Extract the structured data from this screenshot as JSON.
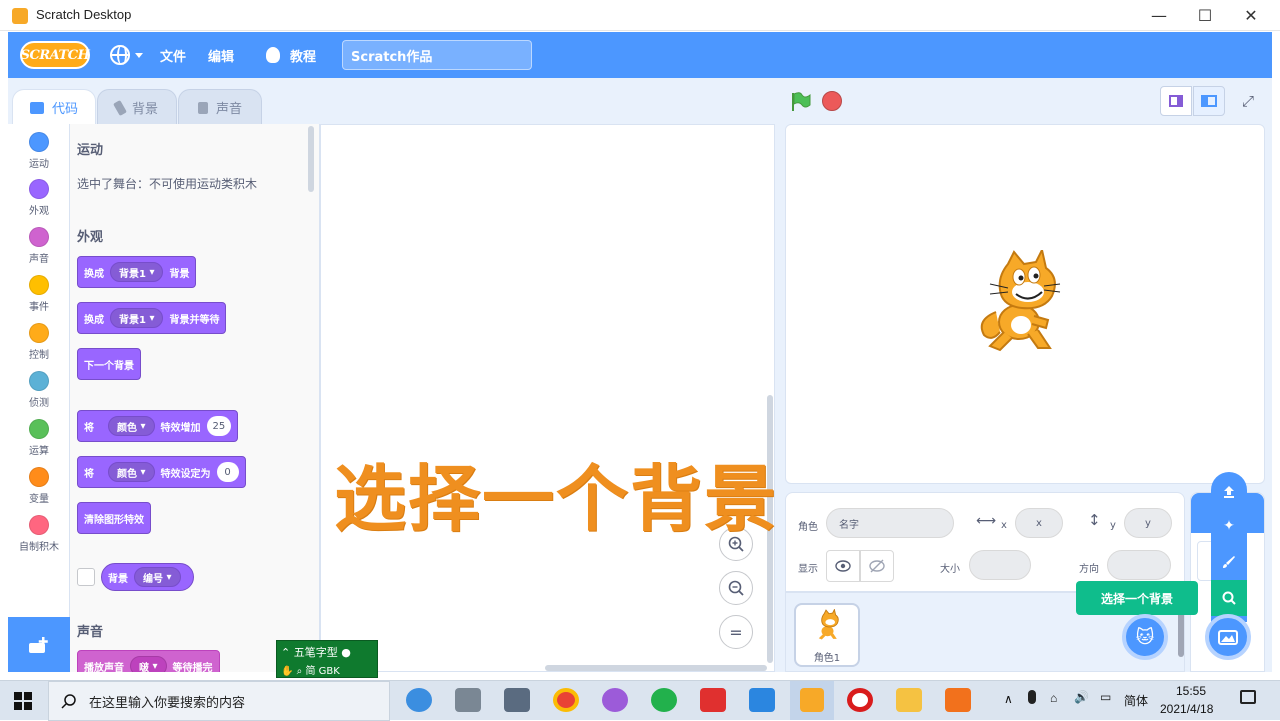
{
  "window": {
    "title": "Scratch Desktop",
    "minimize": "—",
    "maximize": "☐",
    "close": "✕"
  },
  "menubar": {
    "logo": "SCRATCH",
    "file": "文件",
    "edit": "编辑",
    "tutorials": "教程",
    "project_title": "Scratch作品"
  },
  "tabs": [
    {
      "label": "代码",
      "active": true
    },
    {
      "label": "背景",
      "active": false
    },
    {
      "label": "声音",
      "active": false
    }
  ],
  "categories": [
    {
      "label": "运动",
      "color": "#4c97ff"
    },
    {
      "label": "外观",
      "color": "#9966ff"
    },
    {
      "label": "声音",
      "color": "#cf63cf"
    },
    {
      "label": "事件",
      "color": "#ffbf00"
    },
    {
      "label": "控制",
      "color": "#ffab19"
    },
    {
      "label": "侦测",
      "color": "#5cb1d6"
    },
    {
      "label": "运算",
      "color": "#59c059"
    },
    {
      "label": "变量",
      "color": "#ff8c1a"
    },
    {
      "label": "自制积木",
      "color": "#ff6680"
    }
  ],
  "palette": {
    "motion_heading": "运动",
    "motion_note": "选中了舞台：不可使用运动类积木",
    "looks_heading": "外观",
    "block1": {
      "text1": "换成",
      "dropdown": "背景1",
      "text2": "背景"
    },
    "block2": {
      "text1": "换成",
      "dropdown": "背景1",
      "text2": "背景并等待"
    },
    "block3": {
      "text1": "下一个背景"
    },
    "block4": {
      "text1": "将",
      "dropdown": "颜色",
      "text2": "特效增加",
      "value": "25"
    },
    "block5": {
      "text1": "将",
      "dropdown": "颜色",
      "text2": "特效设定为",
      "value": "0"
    },
    "block6": {
      "text1": "清除图形特效"
    },
    "block7": {
      "text1": "背景",
      "dropdown": "编号"
    },
    "sound_heading": "声音",
    "block8": {
      "text1": "播放声音",
      "dropdown": "啵",
      "text2": "等待播完"
    }
  },
  "overlay_caption": "选择一个背景",
  "zoom": {
    "in": "+",
    "out": "−",
    "reset": "="
  },
  "sprite_info": {
    "sprite_label": "角色",
    "sprite_name_placeholder": "名字",
    "x_label": "x",
    "x_placeholder": "x",
    "y_label": "y",
    "y_placeholder": "y",
    "show_label": "显示",
    "size_label": "大小",
    "direction_label": "方向"
  },
  "sprite_list": [
    {
      "name": "角色1"
    }
  ],
  "tooltip": "选择一个背景",
  "ime": {
    "name": "五笔字型",
    "mode": "简",
    "kb": "GBK"
  },
  "taskbar": {
    "search_placeholder": "在这里输入你要搜索的内容",
    "lang": "简体",
    "time": "15:55",
    "date": "2021/4/18"
  },
  "colors": {
    "accent": "#4c97ff",
    "looks": "#9966ff",
    "sound": "#cf63cf",
    "caption": "#ef8f1f",
    "tooltip": "#0fbd8c"
  }
}
